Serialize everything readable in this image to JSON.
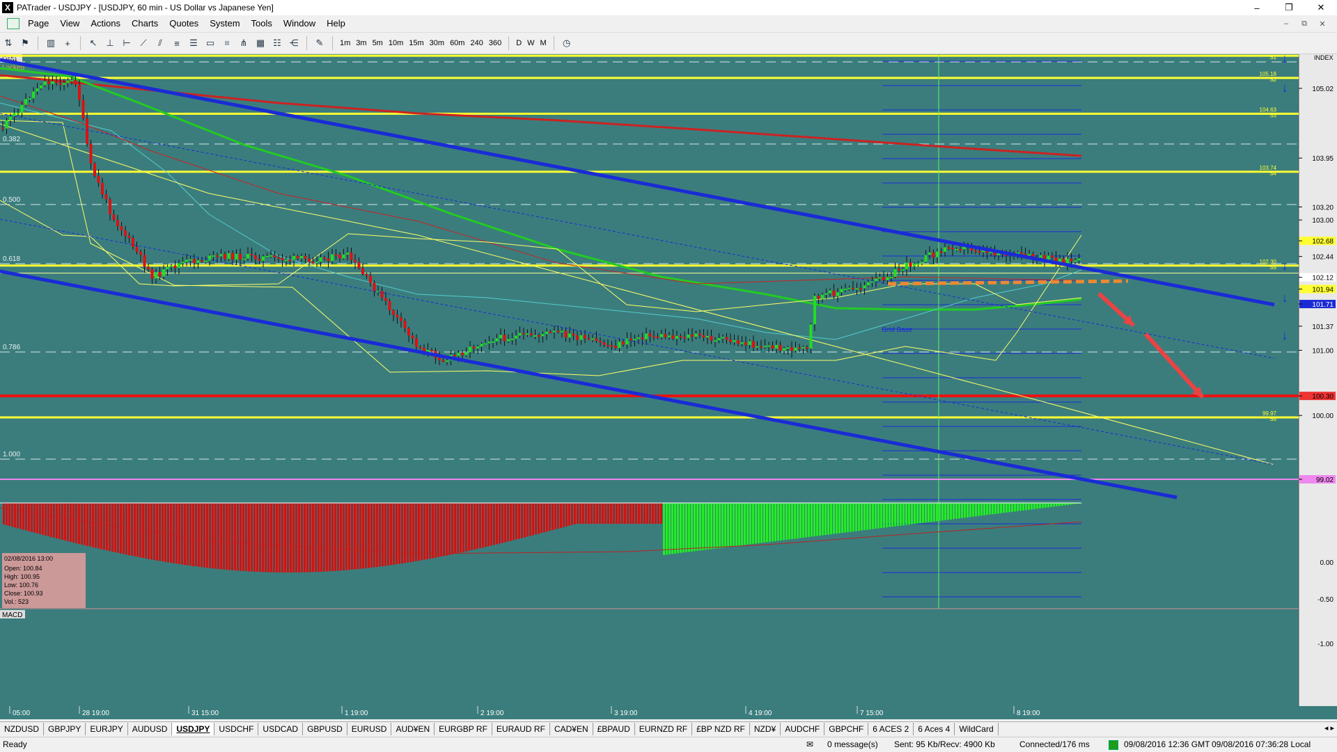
{
  "window": {
    "title": "PATrader - USDJPY - [USDJPY, 60 min - US Dollar vs Japanese Yen]",
    "app_icon": "X",
    "controls": [
      "–",
      "❐",
      "✕"
    ]
  },
  "menu": {
    "items": [
      "Page",
      "View",
      "Actions",
      "Charts",
      "Quotes",
      "System",
      "Tools",
      "Window",
      "Help"
    ],
    "mdi_controls": [
      "–",
      "⧉",
      "✕"
    ]
  },
  "toolbar": {
    "timeframes": [
      "1m",
      "3m",
      "5m",
      "10m",
      "15m",
      "30m",
      "60m",
      "240",
      "360"
    ],
    "periods": [
      "D",
      "W",
      "M"
    ]
  },
  "chart": {
    "data_label": "Data",
    "locked_label": "Locked",
    "index_label": "INDEX",
    "macd_label": "MACD",
    "grid_label": "Grid Base",
    "fib_labels": [
      "0.214",
      "0.382",
      "0.500",
      "0.618",
      "0.786",
      "1.000"
    ],
    "price_ticks": [
      "105.02",
      "103.95",
      "103.20",
      "103.00",
      "102.68",
      "102.44",
      "102.12",
      "101.94",
      "101.71",
      "101.37",
      "101.00",
      "100.30",
      "100.00",
      "99.02"
    ],
    "level_tags": [
      {
        "price": "105.52",
        "tag": "S1"
      },
      {
        "price": "105.18",
        "tag": "S2"
      },
      {
        "price": "104.63",
        "tag": "S3"
      },
      {
        "price": "103.74",
        "tag": "S4"
      },
      {
        "price": "102.30",
        "tag": "S5"
      },
      {
        "price": "99.97",
        "tag": "S6"
      }
    ],
    "macd_ticks": [
      "0.00",
      "-0.50",
      "-1.00"
    ],
    "time_labels": [
      "05:00",
      "28 19:00",
      "31 15:00",
      "1 19:00",
      "2 19:00",
      "3 19:00",
      "4 19:00",
      "7 15:00",
      "8 19:00"
    ],
    "info_box": {
      "date": "02/08/2016 13:00",
      "open": "Open: 100.84",
      "high": "High: 100.95",
      "low": "Low: 100.76",
      "close": "Close: 100.93",
      "vol": "Vol.: 523"
    },
    "colors": {
      "background": "#3b7d7d",
      "bull": "#22dd22",
      "bear": "#dd1111",
      "channel": "#1a2bd6",
      "support_red": "#ee1111",
      "yellow": "#ffff33",
      "ma_red": "#cc2222",
      "ma_green": "#22cc22",
      "ma_cyan": "#55cccc"
    }
  },
  "tabs": {
    "items": [
      "NZDUSD",
      "GBPJPY",
      "EURJPY",
      "AUDUSD",
      "USDJPY",
      "USDCHF",
      "USDCAD",
      "GBPUSD",
      "EURUSD",
      "AUD¥EN",
      "EURGBP RF",
      "EURAUD RF",
      "CAD¥EN",
      "£BPAUD",
      "EURNZD RF",
      "£BP NZD RF",
      "NZD¥",
      "AUDCHF",
      "GBPCHF",
      "6 ACES 2",
      "6 Aces 4",
      "WildCard"
    ],
    "active_index": 4,
    "arrows": "◂ ▸"
  },
  "status": {
    "ready": "Ready",
    "messages": "0 message(s)",
    "traffic": "Sent: 95 Kb/Recv: 4900 Kb",
    "connection": "Connected/176 ms",
    "gmt_time": "09/08/2016 12:36 GMT",
    "local_time": "09/08/2016 07:36:28 Local"
  }
}
